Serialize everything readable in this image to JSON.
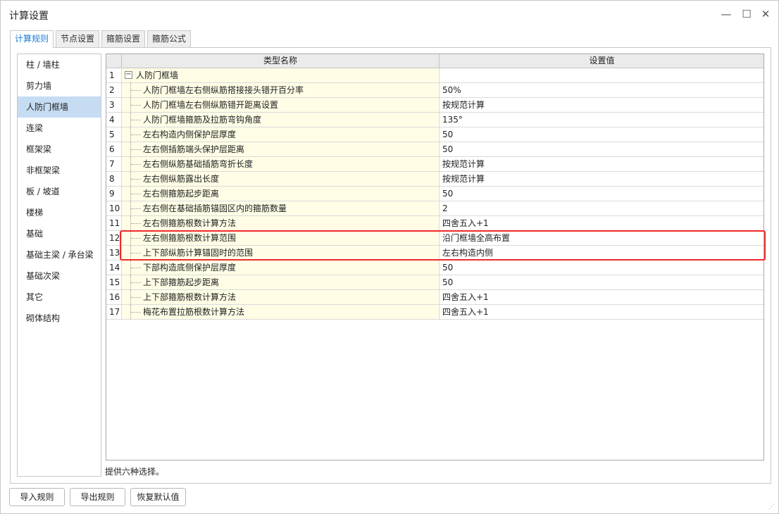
{
  "window": {
    "title": "计算设置",
    "minimize": "—",
    "maximize": "☐",
    "close": "✕"
  },
  "tabs": [
    {
      "label": "计算规则",
      "active": true
    },
    {
      "label": "节点设置",
      "active": false
    },
    {
      "label": "箍筋设置",
      "active": false
    },
    {
      "label": "箍筋公式",
      "active": false
    }
  ],
  "sidebar": {
    "items": [
      {
        "label": "柱 / 墙柱",
        "active": false
      },
      {
        "label": "剪力墙",
        "active": false
      },
      {
        "label": "人防门框墙",
        "active": true
      },
      {
        "label": "连梁",
        "active": false
      },
      {
        "label": "框架梁",
        "active": false
      },
      {
        "label": "非框架梁",
        "active": false
      },
      {
        "label": "板 / 坡道",
        "active": false
      },
      {
        "label": "楼梯",
        "active": false
      },
      {
        "label": "基础",
        "active": false
      },
      {
        "label": "基础主梁 / 承台梁",
        "active": false
      },
      {
        "label": "基础次梁",
        "active": false
      },
      {
        "label": "其它",
        "active": false
      },
      {
        "label": "砌体结构",
        "active": false
      }
    ]
  },
  "grid": {
    "headers": {
      "name": "类型名称",
      "value": "设置值"
    },
    "group": {
      "num": "1",
      "toggle": "−",
      "label": "人防门框墙"
    },
    "rows": [
      {
        "num": "2",
        "name": "人防门框墙左右侧纵筋搭接接头错开百分率",
        "value": "50%"
      },
      {
        "num": "3",
        "name": "人防门框墙左右侧纵筋错开距离设置",
        "value": "按规范计算"
      },
      {
        "num": "4",
        "name": "人防门框墙箍筋及拉筋弯钩角度",
        "value": "135°"
      },
      {
        "num": "5",
        "name": "左右构造内侧保护层厚度",
        "value": "50"
      },
      {
        "num": "6",
        "name": "左右侧插筋端头保护层距离",
        "value": "50"
      },
      {
        "num": "7",
        "name": "左右侧纵筋基础插筋弯折长度",
        "value": "按规范计算"
      },
      {
        "num": "8",
        "name": "左右侧纵筋露出长度",
        "value": "按规范计算"
      },
      {
        "num": "9",
        "name": "左右侧箍筋起步距离",
        "value": "50"
      },
      {
        "num": "10",
        "name": "左右侧在基础插筋锚固区内的箍筋数量",
        "value": "2"
      },
      {
        "num": "11",
        "name": "左右侧箍筋根数计算方法",
        "value": "四舍五入+1"
      },
      {
        "num": "12",
        "name": "左右侧箍筋根数计算范围",
        "value": "沿门框墙全高布置"
      },
      {
        "num": "13",
        "name": "上下部纵筋计算锚固时的范围",
        "value": "左右构造内侧"
      },
      {
        "num": "14",
        "name": "下部构造底侧保护层厚度",
        "value": "50"
      },
      {
        "num": "15",
        "name": "上下部箍筋起步距离",
        "value": "50"
      },
      {
        "num": "16",
        "name": "上下部箍筋根数计算方法",
        "value": "四舍五入+1"
      },
      {
        "num": "17",
        "name": "梅花布置拉筋根数计算方法",
        "value": "四舍五入+1"
      }
    ]
  },
  "hint": "提供六种选择。",
  "buttons": {
    "import": "导入规则",
    "export": "导出规则",
    "reset": "恢复默认值"
  },
  "colors": {
    "highlight": "#ef2b2b",
    "active_tab": "#1e7bd7",
    "active_sidebar": "#c6dcf3",
    "name_cell_bg": "#fffde6"
  }
}
